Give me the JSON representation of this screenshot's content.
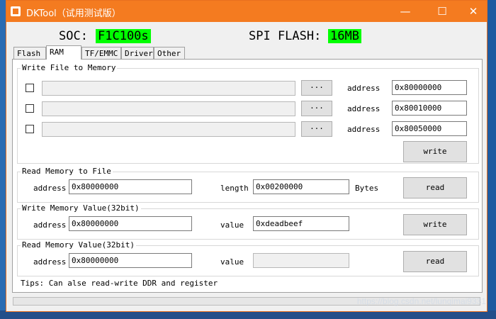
{
  "window": {
    "title": "DKTool（试用测试版）",
    "controls": {
      "minimize": "—",
      "maximize": "☐",
      "close": "✕"
    },
    "accent": "#f47b20"
  },
  "info": {
    "soc_label": "SOC:",
    "soc_value": "F1C100s",
    "flash_label": "SPI FLASH:",
    "flash_value": "16MB",
    "highlight": "#00ff00"
  },
  "tabs": [
    {
      "label": "Flash",
      "active": false
    },
    {
      "label": "RAM",
      "active": true
    },
    {
      "label": "TF/EMMC",
      "active": false
    },
    {
      "label": "Driver",
      "active": false
    },
    {
      "label": "Other",
      "active": false
    }
  ],
  "write_file": {
    "title": "Write File to Memory",
    "rows": [
      {
        "checked": false,
        "path": "",
        "browse": "···",
        "address_label": "address",
        "address": "0x80000000"
      },
      {
        "checked": false,
        "path": "",
        "browse": "···",
        "address_label": "address",
        "address": "0x80010000"
      },
      {
        "checked": false,
        "path": "",
        "browse": "···",
        "address_label": "address",
        "address": "0x80050000"
      }
    ],
    "button": "write"
  },
  "read_file": {
    "title": "Read Memory to File",
    "address_label": "address",
    "address": "0x80000000",
    "length_label": "length",
    "length": "0x00200000",
    "unit": "Bytes",
    "button": "read"
  },
  "write_value": {
    "title": "Write Memory Value(32bit)",
    "address_label": "address",
    "address": "0x80000000",
    "value_label": "value",
    "value": "0xdeadbeef",
    "button": "write"
  },
  "read_value": {
    "title": "Read Memory Value(32bit)",
    "address_label": "address",
    "address": "0x80000000",
    "value_label": "value",
    "value": "",
    "button": "read"
  },
  "tips": "Tips: Can alse read-write DDR and register",
  "progress": 0,
  "watermark": "https://blog.csdn.net/lunqimai9331"
}
